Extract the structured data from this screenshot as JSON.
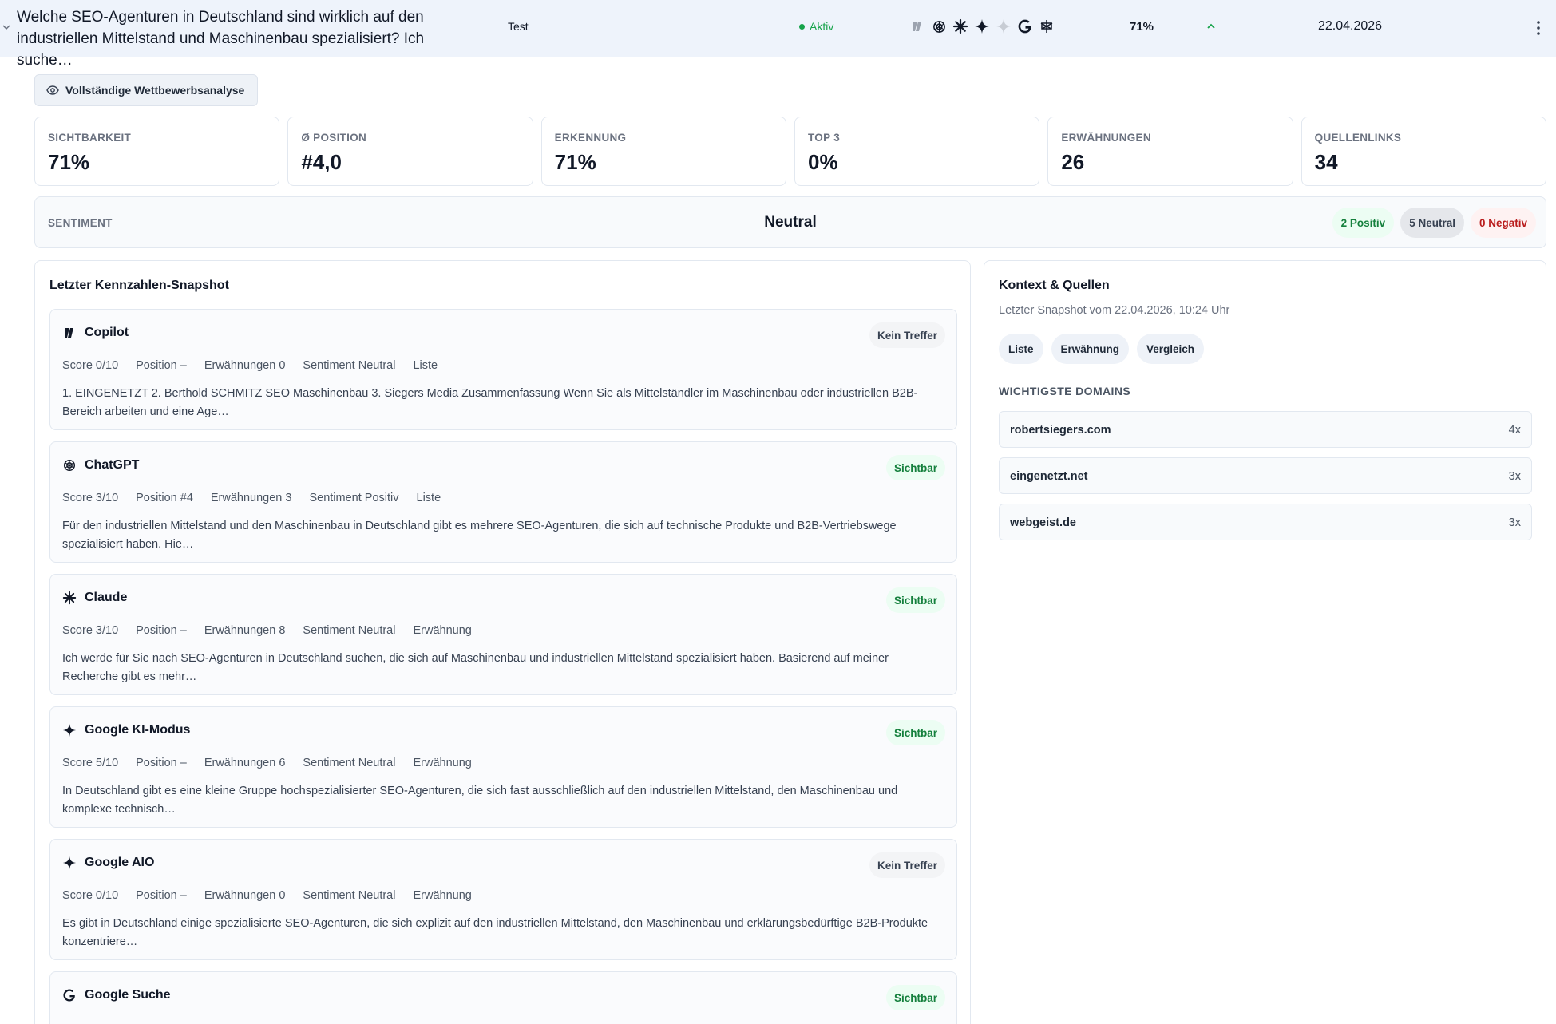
{
  "row": {
    "question": "Welche SEO-Agenturen in Deutschland sind wirklich auf den industriellen Mittelstand und Maschinenbau spezialisiert? Ich suche…",
    "project": "Test",
    "status": "Aktiv",
    "score": "71%",
    "date": "22.04.2026",
    "engine_icons": [
      "copilot-icon",
      "chatgpt-icon",
      "claude-icon",
      "gemini-icon",
      "google-aio-icon",
      "google-icon",
      "perplexity-icon"
    ]
  },
  "analysis_button": "Vollständige Wettbewerbsanalyse",
  "stats": [
    {
      "label": "SICHTBARKEIT",
      "value": "71%"
    },
    {
      "label": "Ø POSITION",
      "value": "#4,0"
    },
    {
      "label": "ERKENNUNG",
      "value": "71%"
    },
    {
      "label": "TOP 3",
      "value": "0%"
    },
    {
      "label": "ERWÄHNUNGEN",
      "value": "26"
    },
    {
      "label": "QUELLENLINKS",
      "value": "34"
    }
  ],
  "sentiment": {
    "label": "SENTIMENT",
    "value": "Neutral",
    "positive": "2 Positiv",
    "neutral": "5 Neutral",
    "negative": "0 Negativ"
  },
  "snapshot": {
    "title": "Letzter Kennzahlen-Snapshot",
    "cards": [
      {
        "name": "Copilot",
        "icon": "copilot-icon",
        "badge": "Kein Treffer",
        "hit": false,
        "score": "Score 0/10",
        "position": "Position –",
        "mentions": "Erwähnungen 0",
        "sentiment": "Sentiment Neutral",
        "type": "Liste",
        "text": "1. EINGENETZT 2. Berthold SCHMITZ SEO Maschinenbau 3. Siegers Media Zusammenfassung Wenn Sie als Mittelständler im Maschinenbau oder industriellen B2B-Bereich arbeiten und eine Age…"
      },
      {
        "name": "ChatGPT",
        "icon": "chatgpt-icon",
        "badge": "Sichtbar",
        "hit": true,
        "score": "Score 3/10",
        "position": "Position #4",
        "mentions": "Erwähnungen 3",
        "sentiment": "Sentiment Positiv",
        "type": "Liste",
        "text": "Für den industriellen Mittelstand und den Maschinenbau in Deutschland gibt es mehrere SEO-Agenturen, die sich auf technische Produkte und B2B-Vertriebswege spezialisiert haben. Hie…"
      },
      {
        "name": "Claude",
        "icon": "claude-icon",
        "badge": "Sichtbar",
        "hit": true,
        "score": "Score 3/10",
        "position": "Position –",
        "mentions": "Erwähnungen 8",
        "sentiment": "Sentiment Neutral",
        "type": "Erwähnung",
        "text": "Ich werde für Sie nach SEO-Agenturen in Deutschland suchen, die sich auf Maschinenbau und industriellen Mittelstand spezialisiert haben. Basierend auf meiner Recherche gibt es mehr…"
      },
      {
        "name": "Google KI-Modus",
        "icon": "gemini-icon",
        "badge": "Sichtbar",
        "hit": true,
        "score": "Score 5/10",
        "position": "Position –",
        "mentions": "Erwähnungen 6",
        "sentiment": "Sentiment Neutral",
        "type": "Erwähnung",
        "text": "In Deutschland gibt es eine kleine Gruppe hochspezialisierter SEO-Agenturen, die sich fast ausschließlich auf den industriellen Mittelstand, den Maschinenbau und komplexe technisch…"
      },
      {
        "name": "Google AIO",
        "icon": "gemini-icon",
        "badge": "Kein Treffer",
        "hit": false,
        "score": "Score 0/10",
        "position": "Position –",
        "mentions": "Erwähnungen 0",
        "sentiment": "Sentiment Neutral",
        "type": "Erwähnung",
        "text": "Es gibt in Deutschland einige spezialisierte SEO-Agenturen, die sich explizit auf den industriellen Mittelstand, den Maschinenbau und erklärungsbedürftige B2B-Produkte konzentriere…"
      },
      {
        "name": "Google Suche",
        "icon": "google-icon",
        "badge": "Sichtbar",
        "hit": true,
        "score": "",
        "position": "",
        "mentions": "",
        "sentiment": "",
        "type": "",
        "text": ""
      }
    ]
  },
  "context": {
    "title": "Kontext & Quellen",
    "subtitle": "Letzter Snapshot vom 22.04.2026, 10:24 Uhr",
    "tags": [
      "Liste",
      "Erwähnung",
      "Vergleich"
    ],
    "domains_heading": "WICHTIGSTE DOMAINS",
    "domains": [
      {
        "name": "robertsiegers.com",
        "count": "4x"
      },
      {
        "name": "eingenetzt.net",
        "count": "3x"
      },
      {
        "name": "webgeist.de",
        "count": "3x"
      }
    ]
  }
}
